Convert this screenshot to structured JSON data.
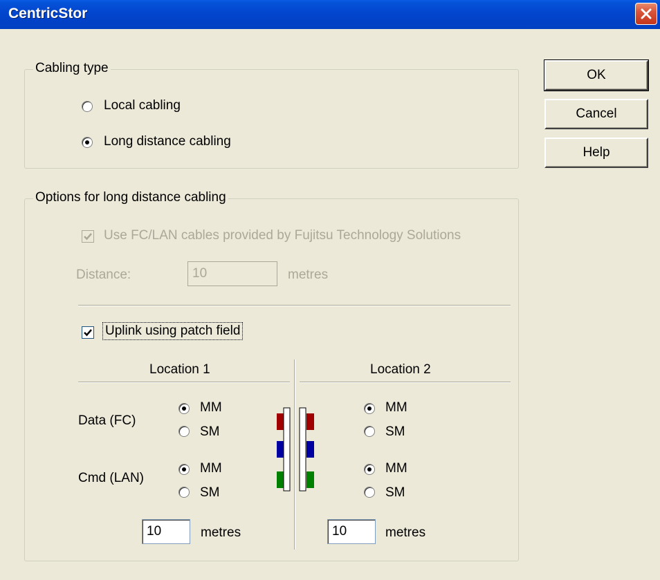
{
  "window": {
    "title": "CentricStor"
  },
  "buttons": {
    "ok": "OK",
    "cancel": "Cancel",
    "help": "Help"
  },
  "cabling_type": {
    "legend": "Cabling type",
    "options": [
      {
        "label": "Local cabling",
        "selected": false
      },
      {
        "label": "Long distance cabling",
        "selected": true
      }
    ]
  },
  "long_distance": {
    "legend": "Options for long distance cabling",
    "use_fc_lan": {
      "label": "Use FC/LAN cables provided by Fujitsu Technology Solutions",
      "checked": true,
      "disabled": true
    },
    "distance": {
      "label": "Distance:",
      "value": "10",
      "unit": "metres",
      "disabled": true
    },
    "uplink": {
      "label": "Uplink using patch field",
      "checked": true
    },
    "location1": {
      "header": "Location 1",
      "data_label": "Data (FC)",
      "cmd_label": "Cmd (LAN)",
      "data_mm": "MM",
      "data_sm": "SM",
      "data_selected": "MM",
      "cmd_mm": "MM",
      "cmd_sm": "SM",
      "cmd_selected": "MM",
      "metres_value": "10",
      "metres_unit": "metres"
    },
    "location2": {
      "header": "Location 2",
      "data_mm": "MM",
      "data_sm": "SM",
      "data_selected": "MM",
      "cmd_mm": "MM",
      "cmd_sm": "SM",
      "cmd_selected": "MM",
      "metres_value": "10",
      "metres_unit": "metres"
    },
    "patch_colors": {
      "data": "#a00000",
      "cmd": "#0000a0",
      "extra": "#008000"
    }
  }
}
